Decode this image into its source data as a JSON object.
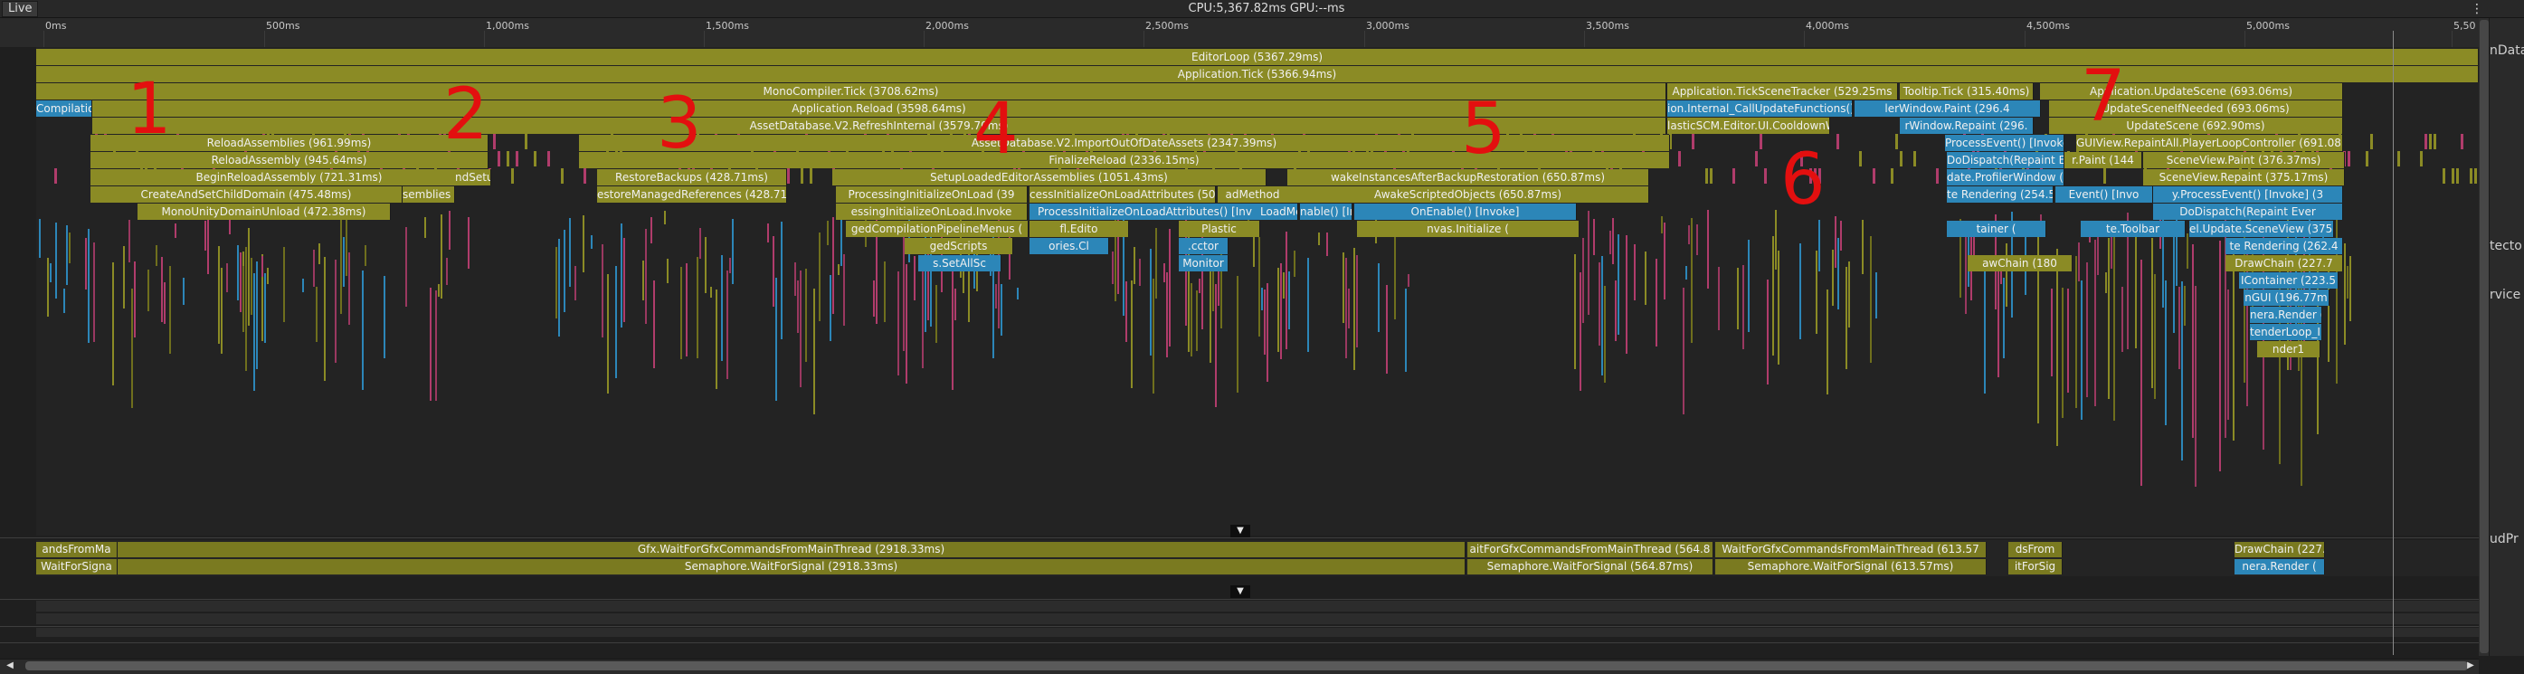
{
  "header": {
    "live_label": "Live",
    "stats": "CPU:5,367.82ms   GPU:--ms",
    "menu_icon": "kebab-icon"
  },
  "ruler": {
    "ticks": [
      "0ms",
      "500ms",
      "1,000ms",
      "1,500ms",
      "2,000ms",
      "2,500ms",
      "3,000ms",
      "3,500ms",
      "4,000ms",
      "4,500ms",
      "5,000ms",
      "5,50"
    ]
  },
  "flame_rows": [
    [
      {
        "label": "EditorLoop (5367.29ms)"
      }
    ],
    [
      {
        "label": "Application.Tick (5366.94ms)"
      }
    ],
    [
      {
        "label": "MonoCompiler.Tick (3708.62ms)"
      },
      {
        "label": "Application.TickSceneTracker (529.25ms"
      },
      {
        "label": "Tooltip.Tick (315.40ms)"
      },
      {
        "label": "Application.UpdateScene (693.06ms)"
      }
    ],
    [
      {
        "label": "Compilatio"
      },
      {
        "label": "Application.Reload (3598.64ms)"
      },
      {
        "label": "ion.Internal_CallUpdateFunctions() [Invo"
      },
      {
        "label": "lerWindow.Paint (296.4"
      },
      {
        "label": "UpdateSceneIfNeeded (693.06ms)"
      }
    ],
    [
      {
        "label": "AssetDatabase.V2.RefreshInternal (3579.70ms)"
      },
      {
        "label": "lasticSCM.Editor.UI.CooldownWind"
      },
      {
        "label": "rWindow.Repaint (296."
      },
      {
        "label": "UpdateScene (692.90ms)"
      }
    ],
    [
      {
        "label": "ReloadAssemblies (961.99ms)"
      },
      {
        "label": "AssetDatabase.V2.ImportOutOfDateAssets (2347.39ms)"
      },
      {
        "label": "ProcessEvent() [Invoke]"
      },
      {
        "label": "GUIView.RepaintAll.PlayerLoopController (691.08ms)"
      }
    ],
    [
      {
        "label": "ReloadAssembly (945.64ms)"
      },
      {
        "label": "FinalizeReload (2336.15ms)"
      },
      {
        "label": "DoDispatch(Repaint E"
      },
      {
        "label": "r.Paint (144"
      },
      {
        "label": "SceneView.Paint (376.37ms)"
      }
    ],
    [
      {
        "label": "BeginReloadAssembly (721.31ms)"
      },
      {
        "label": "ndSetup"
      },
      {
        "label": "RestoreBackups (428.71ms)"
      },
      {
        "label": "SetupLoadedEditorAssemblies (1051.43ms)"
      },
      {
        "label": "wakeInstancesAfterBackupRestoration (650.87ms)"
      },
      {
        "label": "date.ProfilerWindow (2"
      },
      {
        "label": "SceneView.Repaint (375.17ms)"
      }
    ],
    [
      {
        "label": "CreateAndSetChildDomain (475.48ms)"
      },
      {
        "label": "semblies (1"
      },
      {
        "label": "estoreManagedReferences (428.71"
      },
      {
        "label": "ProcessingInitializeOnLoad (39"
      },
      {
        "label": "cessInitializeOnLoadAttributes (501.91"
      },
      {
        "label": "adMethod"
      },
      {
        "label": "AwakeScriptedObjects (650.87ms)"
      },
      {
        "label": "te Rendering (254.5"
      },
      {
        "label": "Event() [Invo"
      },
      {
        "label": "y.ProcessEvent() [Invoke] (3"
      }
    ],
    [
      {
        "label": "MonoUnityDomainUnload (472.38ms)"
      },
      {
        "label": "essingInitializeOnLoad.Invoke"
      },
      {
        "label": "ProcessInitializeOnLoadAttributes() [Inv"
      },
      {
        "label": "LoadMet"
      },
      {
        "label": "nable() [In"
      },
      {
        "label": "OnEnable() [Invoke]"
      },
      {
        "label": "DoDispatch(Repaint Ever"
      }
    ],
    [
      {
        "label": "gedCompilationPipelineMenus ("
      },
      {
        "label": "fl.Edito"
      },
      {
        "label": "Plastic"
      },
      {
        "label": "nvas.Initialize ("
      },
      {
        "label": "tainer ("
      },
      {
        "label": "te.Toolbar"
      },
      {
        "label": "el.Update.SceneView (375.07"
      }
    ],
    [
      {
        "label": "gedScripts"
      },
      {
        "label": "ories.Cl"
      },
      {
        "label": ".cctor"
      },
      {
        "label": "te Rendering (262.4"
      }
    ],
    [
      {
        "label": "s.SetAllSc"
      },
      {
        "label": "Monitor"
      },
      {
        "label": "awChain (180"
      },
      {
        "label": "DrawChain (227.7"
      }
    ],
    [
      {
        "label": "IContainer (223.5"
      }
    ],
    [
      {
        "label": "nGUI (196.77m"
      }
    ],
    [
      {
        "label": "nera.Render ("
      }
    ],
    [
      {
        "label": "tenderLoop_In"
      }
    ],
    [
      {
        "label": "nder1"
      }
    ]
  ],
  "render_rows": [
    [
      {
        "label": "andsFromMa"
      },
      {
        "label": "Gfx.WaitForGfxCommandsFromMainThread (2918.33ms)"
      },
      {
        "label": "aitForGfxCommandsFromMainThread (564.8"
      },
      {
        "label": "WaitForGfxCommandsFromMainThread (613.57"
      },
      {
        "label": "dsFrom"
      },
      {
        "label": "DrawChain (227.2"
      }
    ],
    [
      {
        "label": "WaitForSigna"
      },
      {
        "label": "Semaphore.WaitForSignal (2918.33ms)"
      },
      {
        "label": "Semaphore.WaitForSignal (564.87ms)"
      },
      {
        "label": "Semaphore.WaitForSignal (613.57ms)"
      },
      {
        "label": "itForSig"
      },
      {
        "label": "nera.Render ("
      }
    ]
  ],
  "markers": [
    "1",
    "2",
    "3",
    "4",
    "5",
    "6",
    "7"
  ],
  "right_labels": [
    "nData",
    "tecto",
    "rvice",
    "udPr"
  ],
  "colors": {
    "olive": "#8b8b25",
    "blue": "#2c86b8",
    "rose": "#b03c6b",
    "marker": "#e30f0f"
  }
}
